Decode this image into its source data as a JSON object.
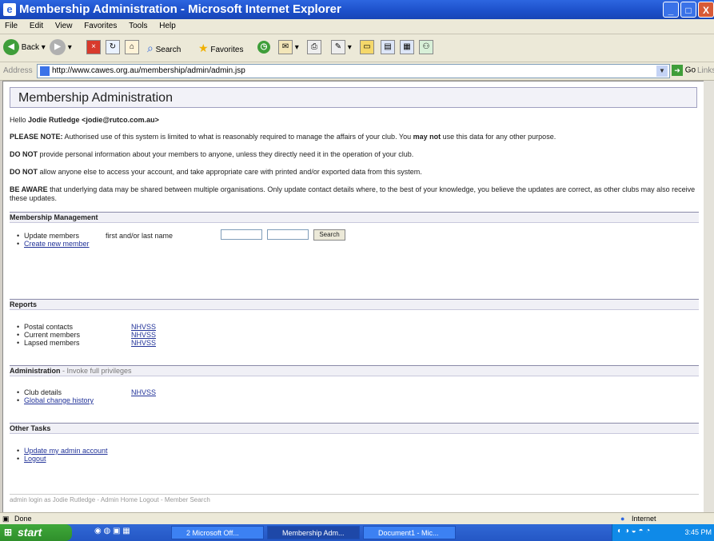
{
  "window": {
    "title": "Membership Administration - Microsoft Internet Explorer",
    "minimize": "_",
    "maximize": "□",
    "close": "X"
  },
  "menu": [
    "File",
    "Edit",
    "View",
    "Favorites",
    "Tools",
    "Help"
  ],
  "toolbar": {
    "back": "Back",
    "search": "Search",
    "favorites": "Favorites"
  },
  "address": {
    "label": "Address",
    "url": "http://www.cawes.org.au/membership/admin/admin.jsp",
    "go": "Go",
    "links": "Links"
  },
  "page": {
    "heading": "Membership Administration",
    "hello_prefix": "Hello",
    "user_name": "Jodie Rutledge",
    "user_email": "<jodie@rutco.com.au>",
    "note1_strong": "PLEASE NOTE:",
    "note1_a": " Authorised use of this system is limited to what is reasonably required to manage the affairs of your club. You ",
    "note1_strong2": "may not",
    "note1_b": " use this data for any other purpose.",
    "note2_strong": "DO NOT",
    "note2_text": " provide personal information about your members to anyone, unless they directly need it in the operation of your club.",
    "note3_strong": "DO NOT",
    "note3_text": " allow anyone else to access your account, and take appropriate care with printed and/or exported data from this system.",
    "note4_strong": "BE AWARE",
    "note4_text": " that underlying data may be shared between multiple organisations. Only update contact details where, to the best of your knowledge, you believe the updates are correct, as other clubs may also receive these updates.",
    "membership": {
      "title": "Membership Management",
      "update_members": "Update members",
      "name_label": "first and/or last name",
      "search_button": "Search",
      "create_member": "Create new member"
    },
    "reports": {
      "title": "Reports",
      "items": [
        {
          "label": "Postal contacts",
          "link": "NHVSS"
        },
        {
          "label": "Current members",
          "link": "NHVSS"
        },
        {
          "label": "Lapsed members",
          "link": "NHVSS"
        }
      ]
    },
    "administration": {
      "title": "Administration",
      "sub": " - Invoke full privileges",
      "club_details": "Club details",
      "club_link": "NHVSS",
      "global_history": "Global change history"
    },
    "other": {
      "title": "Other Tasks",
      "update_account": "Update my admin account",
      "logout": "Logout"
    },
    "footer": "admin login as Jodie Rutledge  -  Admin Home  Logout  -  Member Search"
  },
  "status": {
    "done": "Done",
    "zone": "Internet"
  },
  "taskbar": {
    "start": "start",
    "tasks": [
      "2 Microsoft Off...",
      "Membership Adm...",
      "Document1 - Mic..."
    ],
    "clock": "3:45 PM"
  }
}
